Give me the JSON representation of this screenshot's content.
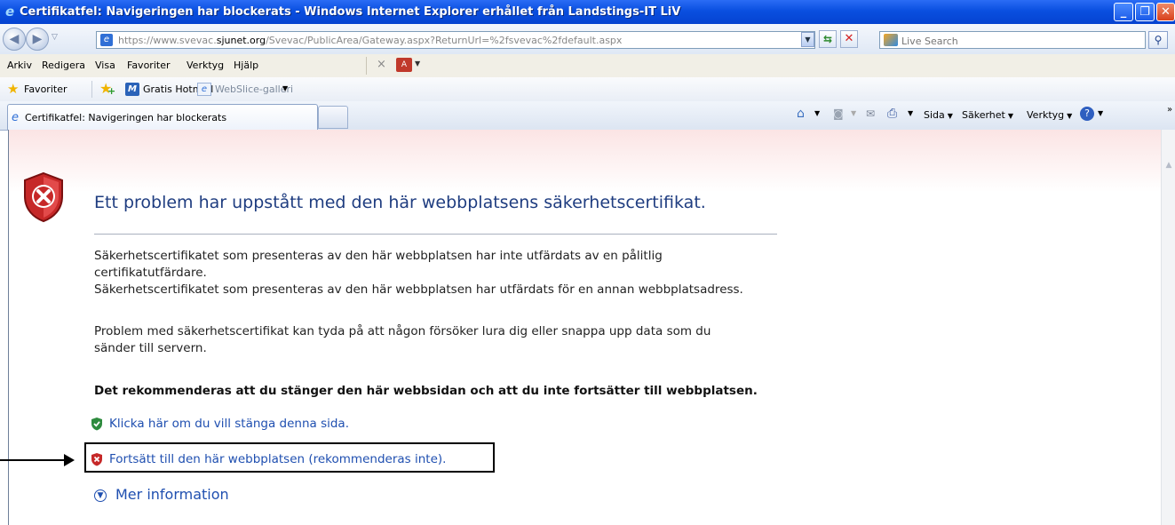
{
  "window": {
    "title": "Certifikatfel: Navigeringen har blockerats - Windows Internet Explorer erhållet från Landstings-IT LiV",
    "min_glyph": "_",
    "max_glyph": "❐",
    "close_glyph": "✕"
  },
  "address_bar": {
    "url_prefix": "https://www.svevac.",
    "url_domain": "sjunet.org",
    "url_suffix": "/Svevac/PublicArea/Gateway.aspx?ReturnUrl=%2fsvevac%2fdefault.aspx",
    "search_placeholder": "Live Search"
  },
  "menu": {
    "items": [
      "Arkiv",
      "Redigera",
      "Visa",
      "Favoriter",
      "Verktyg",
      "Hjälp"
    ]
  },
  "favorites_bar": {
    "favorites_label": "Favoriter",
    "hotmail_label": "Gratis Hotmail",
    "webslice_label": "WebSlice-galleri"
  },
  "tabs": {
    "active_label": "Certifikatfel: Navigeringen har blockerats"
  },
  "command_bar": {
    "page_label": "Sida",
    "security_label": "Säkerhet",
    "tools_label": "Verktyg"
  },
  "content": {
    "heading": "Ett problem har uppstått med den här webbplatsens säkerhetscertifikat.",
    "paragraph_1a": "Säkerhetscertifikatet som presenteras av den här webbplatsen har inte utfärdats av en pålitlig",
    "paragraph_1b": "certifikatutfärdare.",
    "paragraph_2": "Säkerhetscertifikatet som presenteras av den här webbplatsen har utfärdats för en annan webbplatsadress.",
    "paragraph_3a": "Problem med säkerhetscertifikat kan tyda på att någon försöker lura dig eller snappa upp data som du",
    "paragraph_3b": "sänder till servern.",
    "recommendation": "Det rekommenderas att du stänger den här webbsidan och att du inte fortsätter till webbplatsen.",
    "close_link": "Klicka här om du vill stänga denna sida.",
    "continue_link": "Fortsätt till den här webbplatsen (rekommenderas inte).",
    "more_info": "Mer information"
  },
  "colors": {
    "titlebar": "#0a4fe0",
    "link": "#1f4fb0",
    "heading": "#1f3d80",
    "error_red": "#c62828",
    "safe_green": "#2e8b3e"
  }
}
